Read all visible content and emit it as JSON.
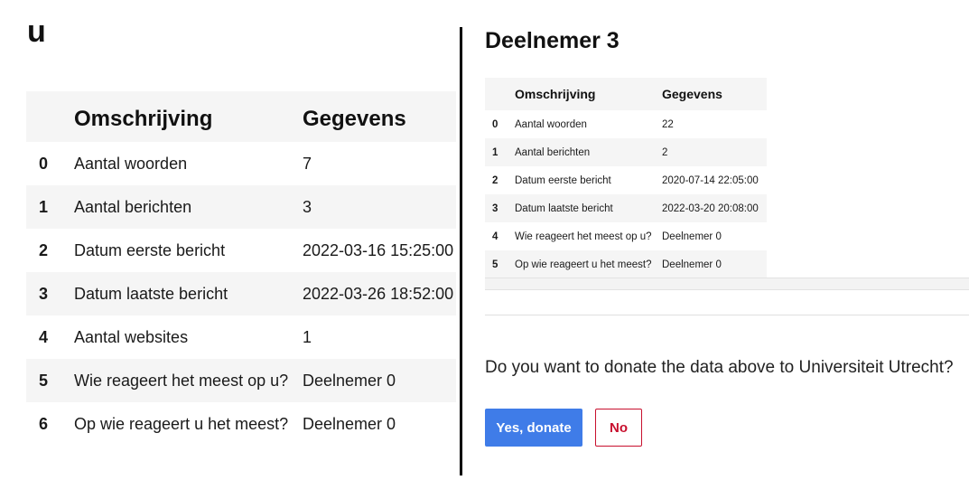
{
  "left_panel": {
    "title": "u",
    "columns": [
      "",
      "Omschrijving",
      "Gegevens"
    ],
    "rows": [
      {
        "index": "0",
        "description": "Aantal woorden",
        "value": "7"
      },
      {
        "index": "1",
        "description": "Aantal berichten",
        "value": "3"
      },
      {
        "index": "2",
        "description": "Datum eerste bericht",
        "value": "2022-03-16 15:25:00"
      },
      {
        "index": "3",
        "description": "Datum laatste bericht",
        "value": "2022-03-26 18:52:00"
      },
      {
        "index": "4",
        "description": "Aantal websites",
        "value": "1"
      },
      {
        "index": "5",
        "description": "Wie reageert het meest op u?",
        "value": "Deelnemer 0"
      },
      {
        "index": "6",
        "description": "Op wie reageert u het meest?",
        "value": "Deelnemer 0"
      }
    ]
  },
  "right_panel": {
    "title": "Deelnemer 3",
    "columns": [
      "",
      "Omschrijving",
      "Gegevens"
    ],
    "rows": [
      {
        "index": "0",
        "description": "Aantal woorden",
        "value": "22"
      },
      {
        "index": "1",
        "description": "Aantal berichten",
        "value": "2"
      },
      {
        "index": "2",
        "description": "Datum eerste bericht",
        "value": "2020-07-14 22:05:00"
      },
      {
        "index": "3",
        "description": "Datum laatste bericht",
        "value": "2022-03-20 20:08:00"
      },
      {
        "index": "4",
        "description": "Wie reageert het meest op u?",
        "value": "Deelnemer 0"
      },
      {
        "index": "5",
        "description": "Op wie reageert u het meest?",
        "value": "Deelnemer 0"
      }
    ],
    "donate_question": "Do you want to donate the data above to Universiteit Utrecht?",
    "yes_button": "Yes, donate",
    "no_button": "No"
  },
  "colors": {
    "primary_button": "#3f7ce8",
    "no_button_accent": "#c8102e",
    "stripe_row": "#f5f5f5",
    "divider": "#000000"
  }
}
